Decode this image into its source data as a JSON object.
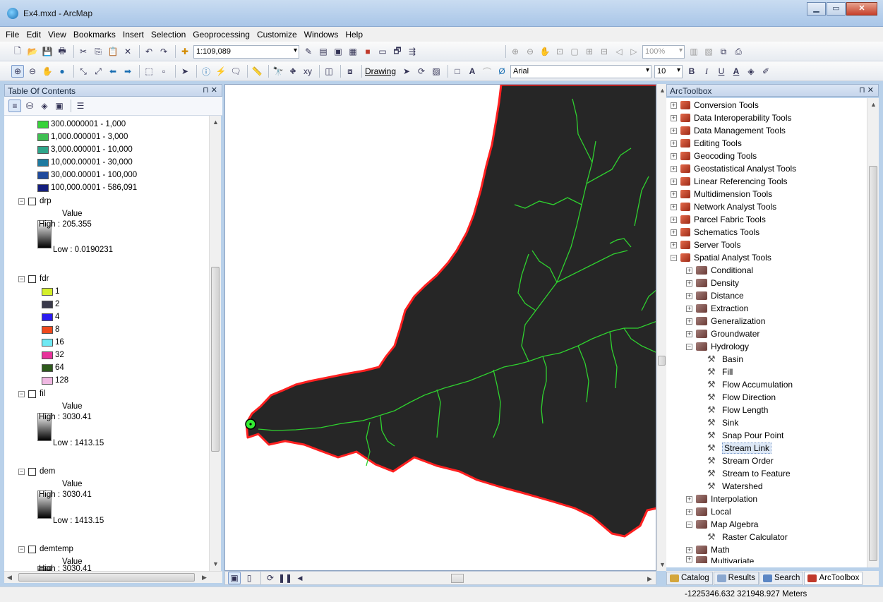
{
  "window": {
    "title": "Ex4.mxd - ArcMap"
  },
  "menu": [
    "File",
    "Edit",
    "View",
    "Bookmarks",
    "Insert",
    "Selection",
    "Geoprocessing",
    "Customize",
    "Windows",
    "Help"
  ],
  "toolbar": {
    "scale": "1:109,089",
    "drawing_label": "Drawing",
    "font": "Arial",
    "font_size": "10",
    "zoom_pct": "100%"
  },
  "toc": {
    "title": "Table Of Contents",
    "pin": "⊓ ✕",
    "classes": [
      {
        "label": "300.0000001 - 1,000",
        "color": "#38d23a"
      },
      {
        "label": "1,000.000001 - 3,000",
        "color": "#3fbf52"
      },
      {
        "label": "3,000.000001 - 10,000",
        "color": "#2ea58a"
      },
      {
        "label": "10,000.00001 - 30,000",
        "color": "#1e7aa0"
      },
      {
        "label": "30,000.00001 - 100,000",
        "color": "#1f4a9c"
      },
      {
        "label": "100,000.0001 - 586,091",
        "color": "#141e7e"
      }
    ],
    "drp": {
      "name": "drp",
      "value": "Value",
      "high": "High : 205.355",
      "low": "Low : 0.0190231"
    },
    "fdr": {
      "name": "fdr",
      "items": [
        {
          "label": "1",
          "color": "#d4ef2a"
        },
        {
          "label": "2",
          "color": "#3a3a4a"
        },
        {
          "label": "4",
          "color": "#2b1cf0"
        },
        {
          "label": "8",
          "color": "#f0491c"
        },
        {
          "label": "16",
          "color": "#6fe9f3"
        },
        {
          "label": "32",
          "color": "#e8339b"
        },
        {
          "label": "64",
          "color": "#2e5a1c"
        },
        {
          "label": "128",
          "color": "#f0b8e2"
        }
      ]
    },
    "fil": {
      "name": "fil",
      "value": "Value",
      "high": "High : 3030.41",
      "low": "Low : 1413.15"
    },
    "dem": {
      "name": "dem",
      "value": "Value",
      "high": "High : 3030.41",
      "low": "Low : 1413.15"
    },
    "demtemp": {
      "name": "demtemp",
      "value": "Value",
      "high": "High : 3030.41"
    }
  },
  "toolbox": {
    "title": "ArcToolbox",
    "pin": "⊓ ✕",
    "toolboxes": [
      "Conversion Tools",
      "Data Interoperability Tools",
      "Data Management Tools",
      "Editing Tools",
      "Geocoding Tools",
      "Geostatistical Analyst Tools",
      "Linear Referencing Tools",
      "Multidimension Tools",
      "Network Analyst Tools",
      "Parcel Fabric Tools",
      "Schematics Tools",
      "Server Tools",
      "Spatial Analyst Tools"
    ],
    "spatial_sets_before": [
      "Conditional",
      "Density",
      "Distance",
      "Extraction",
      "Generalization",
      "Groundwater",
      "Hydrology"
    ],
    "hydrology_tools": [
      "Basin",
      "Fill",
      "Flow Accumulation",
      "Flow Direction",
      "Flow Length",
      "Sink",
      "Snap Pour Point",
      "Stream Link",
      "Stream Order",
      "Stream to Feature",
      "Watershed"
    ],
    "spatial_sets_after": [
      "Interpolation",
      "Local",
      "Map Algebra"
    ],
    "map_algebra_tools": [
      "Raster Calculator"
    ],
    "more_sets": [
      "Math",
      "Multivariate"
    ],
    "selected_tool": "Stream Link"
  },
  "tabs": [
    "Catalog",
    "Results",
    "Search",
    "ArcToolbox"
  ],
  "status": {
    "coords": "-1225346.632  321948.927 Meters"
  },
  "colors": {
    "watershed_fill": "#262626",
    "boundary": "#ff2020",
    "streams": "#2fd12f"
  }
}
